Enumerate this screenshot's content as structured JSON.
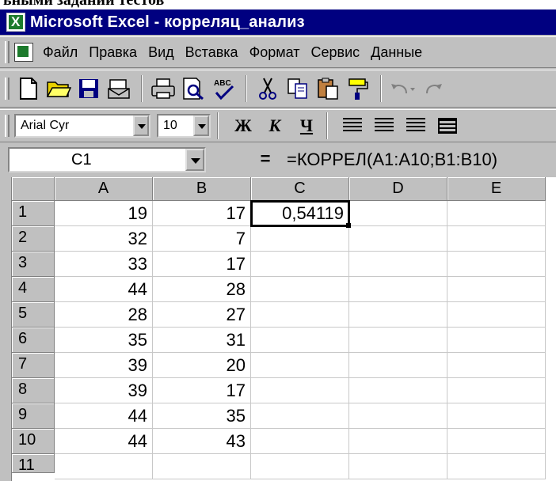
{
  "caption": "ьными задании тестов",
  "window": {
    "title": "Microsoft Excel - корреляц_анализ"
  },
  "menu": {
    "items": [
      {
        "label": "Файл"
      },
      {
        "label": "Правка"
      },
      {
        "label": "Вид"
      },
      {
        "label": "Вставка"
      },
      {
        "label": "Формат"
      },
      {
        "label": "Сервис"
      },
      {
        "label": "Данные"
      }
    ]
  },
  "formatting": {
    "font": "Arial Cyr",
    "size": "10",
    "bold": "Ж",
    "italic": "К",
    "underline": "Ч"
  },
  "formula_bar": {
    "name_box": "C1",
    "equals": "=",
    "formula": "=КОРРЕЛ(A1:A10;B1:B10)"
  },
  "sheet": {
    "columns": [
      "A",
      "B",
      "C",
      "D",
      "E"
    ],
    "rows": [
      {
        "num": "1",
        "A": "19",
        "B": "17",
        "C": "0,54119"
      },
      {
        "num": "2",
        "A": "32",
        "B": "7",
        "C": ""
      },
      {
        "num": "3",
        "A": "33",
        "B": "17",
        "C": ""
      },
      {
        "num": "4",
        "A": "44",
        "B": "28",
        "C": ""
      },
      {
        "num": "5",
        "A": "28",
        "B": "27",
        "C": ""
      },
      {
        "num": "6",
        "A": "35",
        "B": "31",
        "C": ""
      },
      {
        "num": "7",
        "A": "39",
        "B": "20",
        "C": ""
      },
      {
        "num": "8",
        "A": "39",
        "B": "17",
        "C": ""
      },
      {
        "num": "9",
        "A": "44",
        "B": "35",
        "C": ""
      },
      {
        "num": "10",
        "A": "44",
        "B": "43",
        "C": ""
      },
      {
        "num": "11",
        "A": "",
        "B": "",
        "C": ""
      }
    ]
  }
}
